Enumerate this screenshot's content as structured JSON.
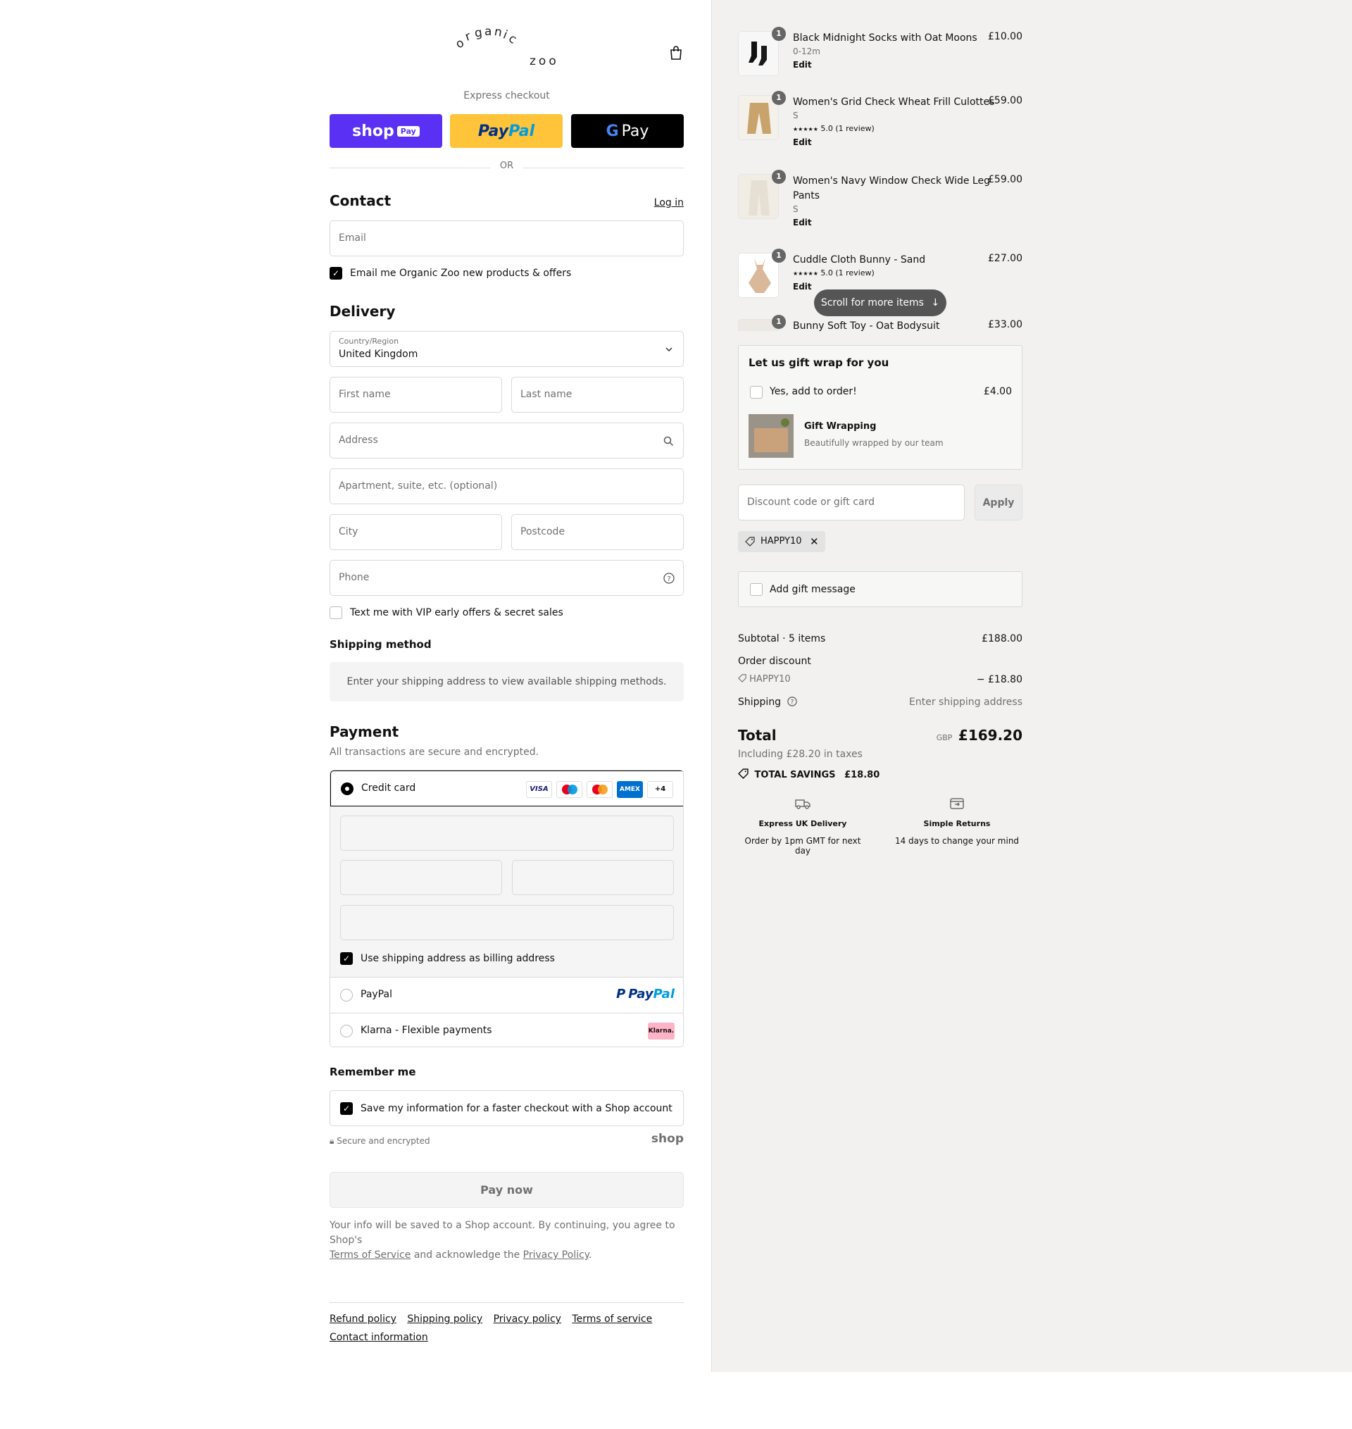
{
  "brand": {
    "logo_top": "organic",
    "logo_bottom": "zoo"
  },
  "express": {
    "label": "Express checkout",
    "shop_pay": "shop",
    "shop_pay_badge": "Pay",
    "paypal_a": "Pay",
    "paypal_b": "Pal",
    "gpay_g": "G",
    "gpay_text": "Pay",
    "or": "OR"
  },
  "contact": {
    "heading": "Contact",
    "login": "Log in",
    "email_placeholder": "Email",
    "newsletter_label": "Email me Organic Zoo new products & offers"
  },
  "delivery": {
    "heading": "Delivery",
    "country_label": "Country/Region",
    "country_value": "United Kingdom",
    "first_name": "First name",
    "last_name": "Last name",
    "address": "Address",
    "apartment": "Apartment, suite, etc. (optional)",
    "city": "City",
    "postcode": "Postcode",
    "phone": "Phone",
    "sms_label": "Text me with VIP early offers & secret sales"
  },
  "shipping_method": {
    "heading": "Shipping method",
    "message": "Enter your shipping address to view available shipping methods."
  },
  "payment": {
    "heading": "Payment",
    "subtitle": "All transactions are secure and encrypted.",
    "credit_card": "Credit card",
    "cards": [
      "VISA",
      "",
      "",
      "AMEX",
      "+4"
    ],
    "billing_label": "Use shipping address as billing address",
    "paypal": "PayPal",
    "paypal_logo_a": "Pay",
    "paypal_logo_b": "Pal",
    "klarna": "Klarna - Flexible payments",
    "klarna_badge": "Klarna."
  },
  "remember": {
    "heading": "Remember me",
    "save_label": "Save my information for a faster checkout with a Shop account",
    "secure": "Secure and encrypted",
    "shop_logo": "shop"
  },
  "pay_now": "Pay now",
  "legal": {
    "text_a": "Your info will be saved to a Shop account. By continuing, you agree to Shop's",
    "tos": "Terms of Service",
    "text_b": "and acknowledge the",
    "privacy": "Privacy Policy",
    "text_c": "."
  },
  "footer_links": [
    "Refund policy",
    "Shipping policy",
    "Privacy policy",
    "Terms of service",
    "Contact information"
  ],
  "cart": {
    "items": [
      {
        "qty": "1",
        "name": "Black Midnight Socks with Oat Moons",
        "variant": "0-12m",
        "price": "£10.00",
        "edit": "Edit",
        "rating": ""
      },
      {
        "qty": "1",
        "name": "Women's Grid Check Wheat Frill Culottes",
        "variant": "S",
        "price": "£59.00",
        "edit": "Edit",
        "rating": "5.0 (1 review)"
      },
      {
        "qty": "1",
        "name_line1": "Women's Navy Window Check Wide Leg",
        "name_line2": "Pants",
        "variant": "S",
        "price": "£59.00",
        "edit": "Edit"
      },
      {
        "qty": "1",
        "name": "Cuddle Cloth Bunny - Sand",
        "price": "£27.00",
        "edit": "Edit",
        "rating": "5.0 (1 review)"
      },
      {
        "qty": "1",
        "name": "Bunny Soft Toy - Oat Bodysuit",
        "price": "£33.00"
      }
    ],
    "stars": "★★★★★",
    "scroll_hint": "Scroll for more items"
  },
  "gift_wrap": {
    "heading": "Let us gift wrap for you",
    "option_label": "Yes, add to order!",
    "option_price": "£4.00",
    "product_name": "Gift Wrapping",
    "product_desc": "Beautifully wrapped by our team"
  },
  "discount": {
    "placeholder": "Discount code or gift card",
    "apply": "Apply",
    "code": "HAPPY10"
  },
  "gift_message": "Add gift message",
  "summary": {
    "subtotal_label": "Subtotal · 5 items",
    "subtotal_value": "£188.00",
    "order_discount_label": "Order discount",
    "discount_code": "HAPPY10",
    "discount_value": "− £18.80",
    "shipping_label": "Shipping",
    "shipping_value": "Enter shipping address",
    "total_label": "Total",
    "currency": "GBP",
    "total_value": "£169.20",
    "taxes": "Including £28.20 in taxes",
    "savings_label": "TOTAL SAVINGS",
    "savings_value": "£18.80"
  },
  "features": [
    {
      "title": "Express UK Delivery",
      "desc": "Order by 1pm GMT for next day"
    },
    {
      "title": "Simple Returns",
      "desc": "14 days to change your mind"
    }
  ],
  "colors": {
    "shop_pay": "#5a31f4",
    "paypal": "#ffc439",
    "right_panel": "#f2f1ef",
    "klarna": "#ffb3c7"
  }
}
